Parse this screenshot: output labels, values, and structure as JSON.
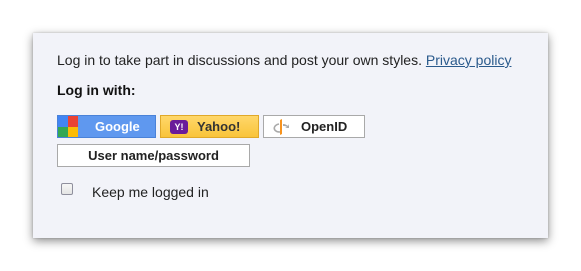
{
  "dialog": {
    "intro_text": "Log in to take part in discussions and post your own styles.",
    "privacy_link": "Privacy policy",
    "heading": "Log in with:",
    "providers": {
      "google": {
        "label": "Google",
        "icon": "google-icon"
      },
      "yahoo": {
        "label": "Yahoo!",
        "icon": "yahoo-icon"
      },
      "openid": {
        "label": "OpenID",
        "icon": "openid-icon"
      }
    },
    "userpass_label": "User name/password",
    "keep_logged_in": {
      "label": "Keep me logged in",
      "checked": false
    }
  },
  "colors": {
    "panel_bg": "#f2f3f9",
    "google_bg": "#5f98ef",
    "yahoo_bg": "#f9c43a",
    "link": "#2a5a8c"
  }
}
